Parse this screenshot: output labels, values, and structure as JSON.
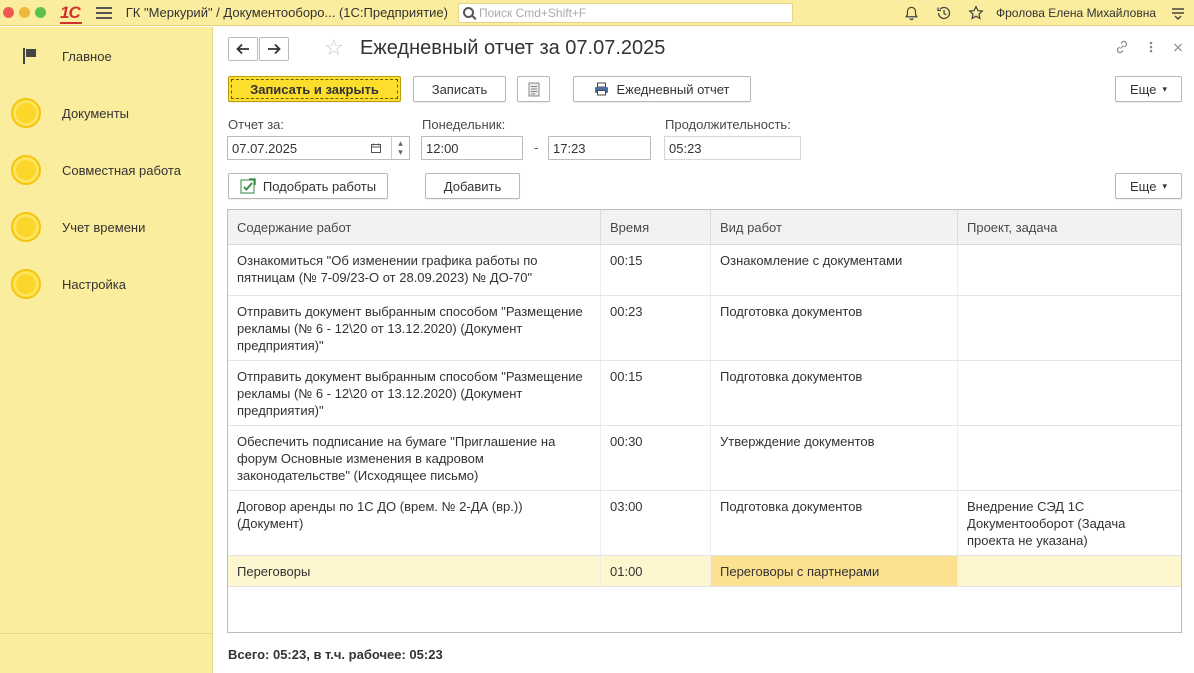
{
  "window": {
    "title": "ГК \"Меркурий\" / Документооборо... (1С:Предприятие)",
    "search_placeholder": "Поиск Cmd+Shift+F",
    "user": "Фролова Елена Михайловна"
  },
  "sidebar": {
    "items": [
      {
        "label": "Главное",
        "icon": "flag-icon"
      },
      {
        "label": "Документы",
        "icon": "yellow-circle-icon"
      },
      {
        "label": "Совместная работа",
        "icon": "yellow-circle-icon"
      },
      {
        "label": "Учет времени",
        "icon": "yellow-circle-icon"
      },
      {
        "label": "Настройка",
        "icon": "yellow-circle-icon"
      }
    ]
  },
  "form": {
    "title": "Ежедневный отчет за 07.07.2025",
    "toolbar": {
      "save_close": "Записать и закрыть",
      "save": "Записать",
      "daily_report": "Ежедневный отчет",
      "more": "Еще"
    },
    "fields": {
      "report_date_label": "Отчет за:",
      "report_date": "07.07.2025",
      "weekday_label": "Понедельник:",
      "time_from": "12:00",
      "time_to": "17:23",
      "duration_label": "Продолжительность:",
      "duration": "05:23",
      "separator": "-"
    },
    "table_toolbar": {
      "pick_works": "Подобрать работы",
      "add": "Добавить",
      "more": "Еще"
    },
    "table": {
      "columns": [
        "Содержание работ",
        "Время",
        "Вид работ",
        "Проект, задача"
      ],
      "rows": [
        {
          "content": "Ознакомиться \"Об изменении графика работы по пятницам (№ 7-09/23-О от 28.09.2023) № ДО-70\"",
          "time": "00:15",
          "kind": "Ознакомление с документами",
          "project": ""
        },
        {
          "content": "Отправить документ выбранным способом \"Размещение рекламы (№ 6 - 12\\20 от 13.12.2020) (Документ предприятия)\"",
          "time": "00:23",
          "kind": "Подготовка документов",
          "project": ""
        },
        {
          "content": "Отправить документ выбранным способом \"Размещение рекламы (№ 6 - 12\\20 от 13.12.2020) (Документ предприятия)\"",
          "time": "00:15",
          "kind": "Подготовка документов",
          "project": ""
        },
        {
          "content": "Обеспечить подписание на бумаге \"Приглашение на форум Основные изменения в кадровом законодательстве\" (Исходящее письмо)",
          "time": "00:30",
          "kind": "Утверждение документов",
          "project": ""
        },
        {
          "content": "Договор аренды по 1С ДО (врем. № 2-ДА (вр.)) (Документ)",
          "time": "03:00",
          "kind": "Подготовка документов",
          "project": "Внедрение СЭД 1С Документооборот (Задача проекта не указана)"
        },
        {
          "content": "Переговоры",
          "time": "01:00",
          "kind": "Переговоры с партнерами",
          "project": ""
        }
      ]
    },
    "total": "Всего: 05:23, в т.ч. рабочее: 05:23"
  },
  "colors": {
    "panel_yellow": "#fbed9e",
    "primary_button": "#fdde2c",
    "selected_row": "#fef6cf",
    "logo_red": "#d0312d"
  }
}
